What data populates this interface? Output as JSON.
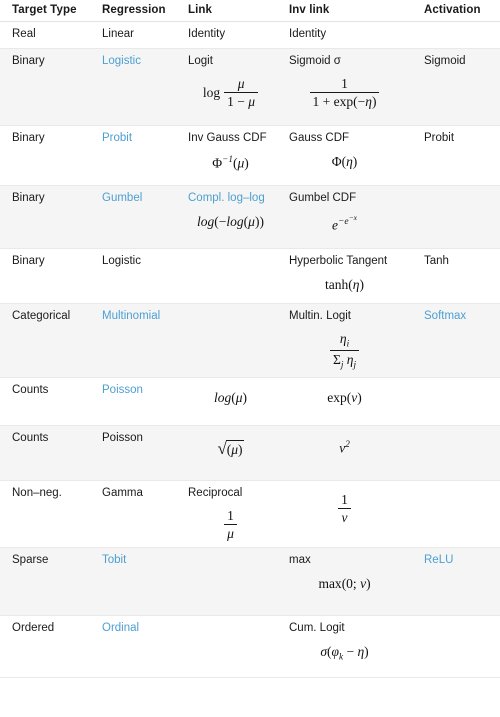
{
  "table": {
    "name": "glm-link-function-table",
    "headers": [
      {
        "key": "target_type",
        "label": "Target Type"
      },
      {
        "key": "regression",
        "label": "Regression"
      },
      {
        "key": "link",
        "label": "Link"
      },
      {
        "key": "inv_link",
        "label": "Inv link"
      },
      {
        "key": "activation",
        "label": "Activation"
      }
    ],
    "accent_link_color": "#4d9fd1",
    "shaded_row_color": "#f5f5f5",
    "plain_row_color": "#ffffff",
    "rows": [
      {
        "shaded": false,
        "target_type": "Real",
        "regression": "Linear",
        "regression_is_link": false,
        "link": "Identity",
        "link_is_link": false,
        "link_formula": "",
        "inv_link": "Identity",
        "inv_link_formula": "",
        "activation": "",
        "activation_is_link": false
      },
      {
        "shaded": true,
        "target_type": "Binary",
        "regression": "Logistic",
        "regression_is_link": true,
        "link": "Logit",
        "link_is_link": false,
        "link_formula": "log μ / (1 − μ)",
        "inv_link": "Sigmoid σ",
        "inv_link_formula": "1 / (1 + exp(−η))",
        "activation": "Sigmoid",
        "activation_is_link": false
      },
      {
        "shaded": false,
        "target_type": "Binary",
        "regression": "Probit",
        "regression_is_link": true,
        "link": "Inv Gauss CDF",
        "link_is_link": false,
        "link_formula": "Φ⁻¹(μ)",
        "inv_link": "Gauss CDF",
        "inv_link_formula": "Φ(η)",
        "activation": "Probit",
        "activation_is_link": false
      },
      {
        "shaded": true,
        "target_type": "Binary",
        "regression": "Gumbel",
        "regression_is_link": true,
        "link": "Compl. log–log",
        "link_is_link": true,
        "link_formula": "log(−log(μ))",
        "inv_link": "Gumbel CDF",
        "inv_link_formula": "e^(−e^(−x))",
        "activation": "",
        "activation_is_link": false
      },
      {
        "shaded": false,
        "target_type": "Binary",
        "regression": "Logistic",
        "regression_is_link": false,
        "link": "",
        "link_is_link": false,
        "link_formula": "",
        "inv_link": "Hyperbolic Tangent",
        "inv_link_formula": "tanh(η)",
        "activation": "Tanh",
        "activation_is_link": false
      },
      {
        "shaded": true,
        "target_type": "Categorical",
        "regression": "Multinomial",
        "regression_is_link": true,
        "link": "",
        "link_is_link": false,
        "link_formula": "",
        "inv_link": "Multin. Logit",
        "inv_link_formula": "η_i / Σ_j η_j",
        "activation": "Softmax",
        "activation_is_link": true
      },
      {
        "shaded": false,
        "target_type": "Counts",
        "regression": "Poisson",
        "regression_is_link": true,
        "link": "",
        "link_is_link": false,
        "link_formula": "log(μ)",
        "inv_link": "",
        "inv_link_formula": "exp(ν)",
        "activation": "",
        "activation_is_link": false
      },
      {
        "shaded": true,
        "target_type": "Counts",
        "regression": "Poisson",
        "regression_is_link": false,
        "link": "",
        "link_is_link": false,
        "link_formula": "√(μ)",
        "inv_link": "",
        "inv_link_formula": "ν²",
        "activation": "",
        "activation_is_link": false
      },
      {
        "shaded": false,
        "target_type": "Non–neg.",
        "regression": "Gamma",
        "regression_is_link": false,
        "link": "Reciprocal",
        "link_is_link": false,
        "link_formula": "1 / μ",
        "inv_link": "",
        "inv_link_formula": "1 / ν",
        "activation": "",
        "activation_is_link": false
      },
      {
        "shaded": true,
        "target_type": "Sparse",
        "regression": "Tobit",
        "regression_is_link": true,
        "link": "",
        "link_is_link": false,
        "link_formula": "",
        "inv_link": "max",
        "inv_link_formula": "max(0; ν)",
        "activation": "ReLU",
        "activation_is_link": true
      },
      {
        "shaded": false,
        "target_type": "Ordered",
        "regression": "Ordinal",
        "regression_is_link": true,
        "link": "",
        "link_is_link": false,
        "link_formula": "",
        "inv_link": "Cum. Logit",
        "inv_link_formula": "σ(φ_k − η)",
        "activation": "",
        "activation_is_link": false
      }
    ]
  }
}
